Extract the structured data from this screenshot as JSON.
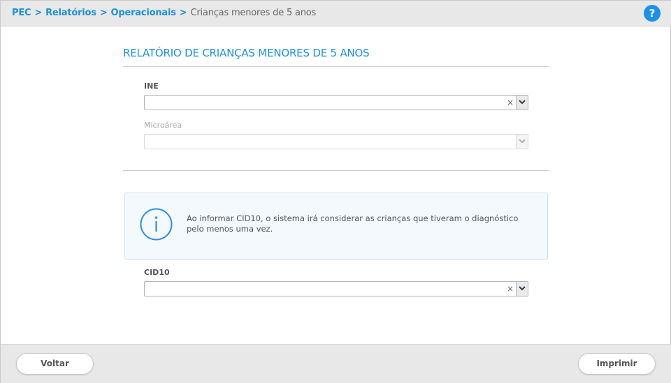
{
  "breadcrumb": {
    "items": [
      "PEC",
      "Relatórios",
      "Operacionais"
    ],
    "separator": ">",
    "current": "Crianças menores de 5 anos"
  },
  "header": {
    "help_label": "?"
  },
  "page_title": "RELATÓRIO DE CRIANÇAS MENORES DE 5 ANOS",
  "form": {
    "ine_label": "INE",
    "ine_value": "",
    "microarea_label": "Microárea",
    "microarea_value": "",
    "cid10_label": "CID10",
    "cid10_value": "",
    "clear_icon": "×"
  },
  "info": {
    "icon": "info-icon",
    "text": "Ao informar CID10, o sistema irá considerar as crianças que tiveram o diagnóstico pelo menos uma vez."
  },
  "footer": {
    "back_label": "Voltar",
    "print_label": "Imprimir"
  },
  "colors": {
    "accent": "#1e90d6",
    "header_bg": "#e8e8e8",
    "info_bg": "#f4f9fd"
  }
}
